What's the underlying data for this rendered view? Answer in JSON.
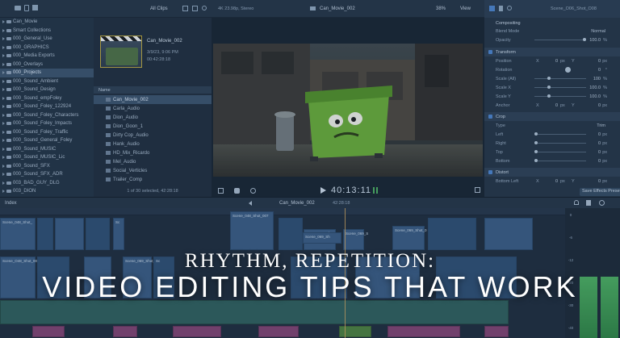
{
  "colors": {
    "accent": "#4a7fc3",
    "timecode": "#d0dce8",
    "meter_green": "#4aa85a",
    "clip_blue": "#38577b",
    "clip_pink": "#7d3f6a"
  },
  "top": {
    "browser_filter": "All Clips",
    "viewer_format": "4K 23.98p, Stereo",
    "viewer_title": "Can_Movie_002",
    "zoom": "38%",
    "view_menu": "View",
    "inspector_clip": "Scene_O06_Shot_O08"
  },
  "sidebar": {
    "items": [
      {
        "label": "Can_Movie",
        "level": 0
      },
      {
        "label": "Smart Collections",
        "level": 1
      },
      {
        "label": "000_General_Use",
        "level": 1
      },
      {
        "label": "000_GRAPHICS",
        "level": 1
      },
      {
        "label": "000_Media Exports",
        "level": 1
      },
      {
        "label": "000_Overlays",
        "level": 1
      },
      {
        "label": "000_Projects",
        "level": 1,
        "selected": true
      },
      {
        "label": "000_Sound_Ambient",
        "level": 1
      },
      {
        "label": "000_Sound_Design",
        "level": 1
      },
      {
        "label": "000_Sound_empFoley",
        "level": 1
      },
      {
        "label": "000_Sound_Foley_122924",
        "level": 1
      },
      {
        "label": "000_Sound_Foley_Characters",
        "level": 1
      },
      {
        "label": "000_Sound_Foley_Impacts",
        "level": 1
      },
      {
        "label": "000_Sound_Foley_Traffic",
        "level": 1
      },
      {
        "label": "000_Sound_General_Foley",
        "level": 1
      },
      {
        "label": "000_Sound_MUSIC",
        "level": 1
      },
      {
        "label": "000_Sound_MUSIC_Lic",
        "level": 1
      },
      {
        "label": "000_Sound_SFX",
        "level": 1
      },
      {
        "label": "000_Sound_SFX_ADR",
        "level": 1
      },
      {
        "label": "003_BAD_GUY_DLG",
        "level": 1
      },
      {
        "label": "003_DION",
        "level": 1
      }
    ]
  },
  "browser": {
    "clip_name": "Can_Movie_002",
    "clip_date": "3/9/23, 9:06 PM",
    "clip_duration": "00:42:28:18",
    "column_header": "Name",
    "rows": [
      {
        "label": "Can_Movie_002",
        "selected": true
      },
      {
        "label": "Carla_Audio"
      },
      {
        "label": "Dion_Audio"
      },
      {
        "label": "Dion_Goon_1"
      },
      {
        "label": "Dirty Cop_Audio"
      },
      {
        "label": "Hank_Audio"
      },
      {
        "label": "HD_Mix_Ricardo"
      },
      {
        "label": "Mel_Audio"
      },
      {
        "label": "Social_Verticles"
      },
      {
        "label": "Trailer_Comp"
      }
    ],
    "status": "1 of 30 selected, 42:28:18"
  },
  "viewer": {
    "timecode": "40:13:11"
  },
  "inspector": {
    "compositing": "Compositing",
    "blend_mode_label": "Blend Mode",
    "blend_mode_value": "Normal",
    "opacity_label": "Opacity",
    "opacity_value": "100.0",
    "opacity_level": 1.0,
    "transform": "Transform",
    "position_label": "Position",
    "rotation_label": "Rotation",
    "rotation_value": "0",
    "scale_all_label": "Scale (All)",
    "scale_all_value": "100",
    "scale_x_label": "Scale X",
    "scale_x_value": "100.0",
    "scale_y_label": "Scale Y",
    "scale_y_value": "100.0",
    "anchor_label": "Anchor",
    "crop": "Crop",
    "type_label": "Type",
    "type_value": "Trim",
    "left_label": "Left",
    "right_label": "Right",
    "top_label": "Top",
    "bottom_label": "Bottom",
    "distort": "Distort",
    "bottom_left_label": "Bottom Left",
    "save_effects": "Save Effects Preset",
    "zero": "0",
    "px": "px",
    "pct": "%",
    "x": "X",
    "y": "Y",
    "deg": "°"
  },
  "timeline": {
    "index_label": "Index",
    "project_name": "Can_Movie_002",
    "project_duration": "42:28:18",
    "clip_labels": {
      "c1": "Scene_048_Shot_",
      "c2": "Scene_048_Shot_007",
      "c3": "Scene_069_Shot_",
      "c4": "Scene_069_S",
      "c5": "Scene_069_Shot_0",
      "c6": "Sc",
      "c7": "Scene_O48_Shot_001",
      "c8": "Scene_069_Shot_",
      "c9": "Sc",
      "c10": "Scene_069_Sh"
    }
  },
  "meters": {
    "db_labels": [
      "0",
      "-6",
      "-12",
      "-20",
      "-30",
      "-40"
    ],
    "level_left": 0.47,
    "level_right": 0.47
  },
  "overlay": {
    "subtitle": "RHYTHM, REPETITION:",
    "title": "VIDEO EDITING TIPS THAT WORK"
  }
}
